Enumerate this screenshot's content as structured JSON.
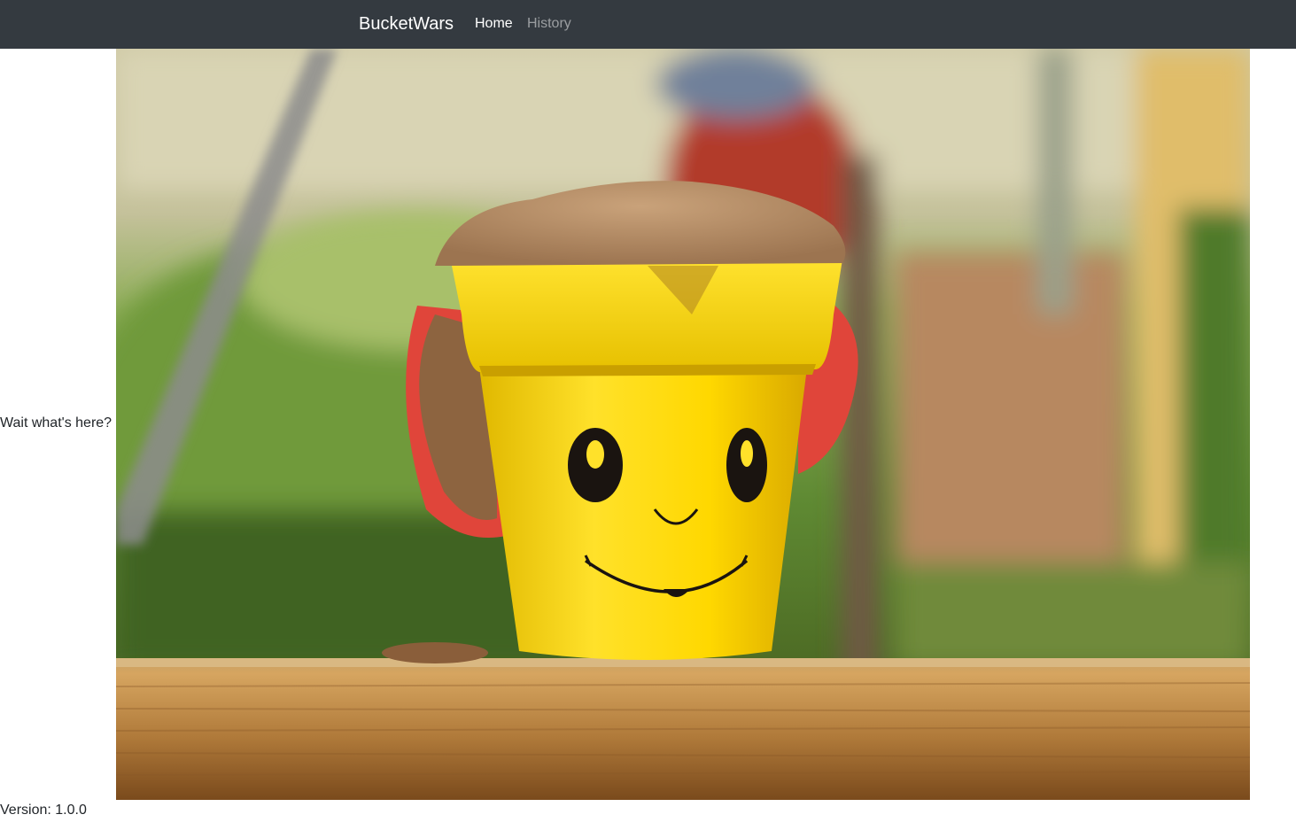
{
  "navbar": {
    "brand": "BucketWars",
    "links": [
      {
        "label": "Home",
        "active": true
      },
      {
        "label": "History",
        "active": false
      }
    ],
    "background_color": "#343a40"
  },
  "main": {
    "side_text": "Wait what's here?",
    "hero_image": {
      "subject": "yellow smiley-face sand bucket on a wooden plank"
    }
  },
  "footer": {
    "version_text": "Version: 1.0.0"
  }
}
